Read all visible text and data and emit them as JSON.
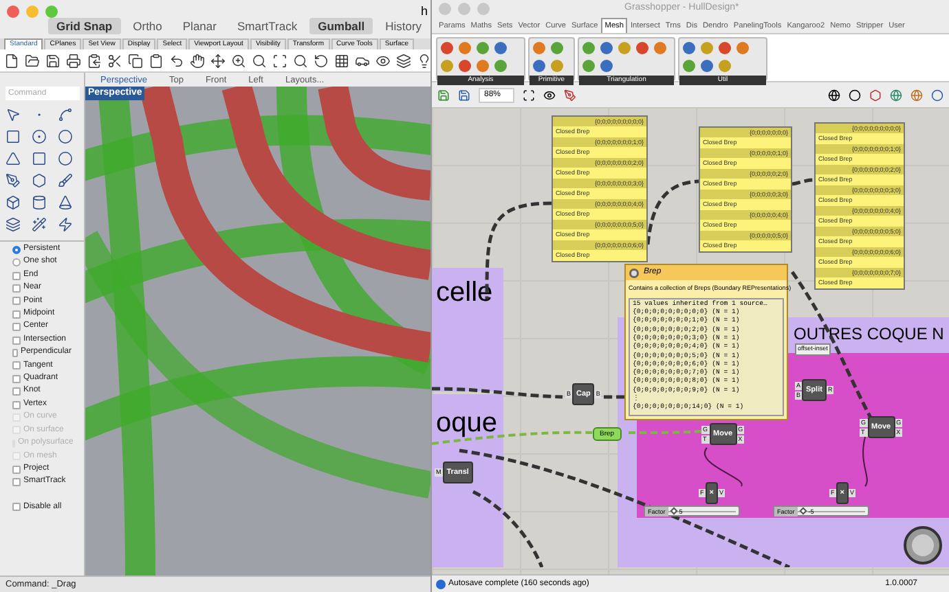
{
  "rhino": {
    "title_fragment": "h",
    "toggles": [
      {
        "label": "Grid Snap",
        "selected": true
      },
      {
        "label": "Ortho",
        "selected": false
      },
      {
        "label": "Planar",
        "selected": false
      },
      {
        "label": "SmartTrack",
        "selected": false
      },
      {
        "label": "Gumball",
        "selected": true
      },
      {
        "label": "History",
        "selected": false
      }
    ],
    "toolbar_tabs": [
      {
        "label": "Standard",
        "selected": true
      },
      {
        "label": "CPlanes",
        "selected": false
      },
      {
        "label": "Set View",
        "selected": false
      },
      {
        "label": "Display",
        "selected": false
      },
      {
        "label": "Select",
        "selected": false
      },
      {
        "label": "Viewport Layout",
        "selected": false
      },
      {
        "label": "Visibility",
        "selected": false
      },
      {
        "label": "Transform",
        "selected": false
      },
      {
        "label": "Curve Tools",
        "selected": false
      },
      {
        "label": "Surface",
        "selected": false
      }
    ],
    "command_field": {
      "placeholder": "Command"
    },
    "osnap": [
      {
        "label": "Persistent",
        "kind": "radio",
        "checked": true,
        "disabled": false
      },
      {
        "label": "One shot",
        "kind": "radio",
        "checked": false,
        "disabled": false
      },
      {
        "label": "End",
        "kind": "check",
        "checked": false,
        "disabled": false
      },
      {
        "label": "Near",
        "kind": "check",
        "checked": false,
        "disabled": false
      },
      {
        "label": "Point",
        "kind": "check",
        "checked": false,
        "disabled": false
      },
      {
        "label": "Midpoint",
        "kind": "check",
        "checked": false,
        "disabled": false
      },
      {
        "label": "Center",
        "kind": "check",
        "checked": false,
        "disabled": false
      },
      {
        "label": "Intersection",
        "kind": "check",
        "checked": false,
        "disabled": false
      },
      {
        "label": "Perpendicular",
        "kind": "check",
        "checked": false,
        "disabled": false
      },
      {
        "label": "Tangent",
        "kind": "check",
        "checked": false,
        "disabled": false
      },
      {
        "label": "Quadrant",
        "kind": "check",
        "checked": false,
        "disabled": false
      },
      {
        "label": "Knot",
        "kind": "check",
        "checked": false,
        "disabled": false
      },
      {
        "label": "Vertex",
        "kind": "check",
        "checked": false,
        "disabled": false
      },
      {
        "label": "On curve",
        "kind": "check",
        "checked": false,
        "disabled": true
      },
      {
        "label": "On surface",
        "kind": "check",
        "checked": false,
        "disabled": true
      },
      {
        "label": "On polysurface",
        "kind": "check",
        "checked": false,
        "disabled": true
      },
      {
        "label": "On mesh",
        "kind": "check",
        "checked": false,
        "disabled": true
      },
      {
        "label": "Project",
        "kind": "check",
        "checked": false,
        "disabled": false
      },
      {
        "label": "SmartTrack",
        "kind": "check",
        "checked": false,
        "disabled": false
      },
      {
        "label": "Disable all",
        "kind": "footer",
        "checked": false,
        "disabled": false
      }
    ],
    "viewport_tabs": [
      {
        "label": "Perspective",
        "selected": true
      },
      {
        "label": "Top",
        "selected": false
      },
      {
        "label": "Front",
        "selected": false
      },
      {
        "label": "Left",
        "selected": false
      },
      {
        "label": "Layouts...",
        "selected": false
      }
    ],
    "viewport_label": "Perspective",
    "command_line": "Command: _Drag"
  },
  "grasshopper": {
    "title": "Grasshopper - HullDesign*",
    "menu_tabs": [
      {
        "label": "Params",
        "selected": false
      },
      {
        "label": "Maths",
        "selected": false
      },
      {
        "label": "Sets",
        "selected": false
      },
      {
        "label": "Vector",
        "selected": false
      },
      {
        "label": "Curve",
        "selected": false
      },
      {
        "label": "Surface",
        "selected": false
      },
      {
        "label": "Mesh",
        "selected": true
      },
      {
        "label": "Intersect",
        "selected": false
      },
      {
        "label": "Trns",
        "selected": false
      },
      {
        "label": "Dis",
        "selected": false
      },
      {
        "label": "Dendro",
        "selected": false
      },
      {
        "label": "PanelingTools",
        "selected": false
      },
      {
        "label": "Kangaroo2",
        "selected": false
      },
      {
        "label": "Nemo",
        "selected": false
      },
      {
        "label": "Stripper",
        "selected": false
      },
      {
        "label": "User",
        "selected": false
      }
    ],
    "ribbon_groups": [
      "Analysis",
      "Primitive",
      "Triangulation",
      "Util"
    ],
    "zoom": "88%",
    "groups": [
      "celle",
      "oque",
      "OUTRES COQUE N"
    ],
    "group_tag": "offset-inset",
    "panels": [
      {
        "rows": [
          {
            "path": "{0;0;0;0;0;0;0;0;0}",
            "value": "Closed Brep"
          },
          {
            "path": "{0;0;0;0;0;0;0;1;0}",
            "value": "Closed Brep"
          },
          {
            "path": "{0;0;0;0;0;0;0;2;0}",
            "value": "Closed Brep"
          },
          {
            "path": "{0;0;0;0;0;0;0;3;0}",
            "value": "Closed Brep"
          },
          {
            "path": "{0;0;0;0;0;0;0;4;0}",
            "value": "Closed Brep"
          },
          {
            "path": "{0;0;0;0;0;0;0;5;0}",
            "value": "Closed Brep"
          },
          {
            "path": "{0;0;0;0;0;0;0;6;0}",
            "value": "Closed Brep"
          }
        ]
      },
      {
        "rows": [
          {
            "path": "{0;0;0;0;0;0;0}",
            "value": "Closed Brep"
          },
          {
            "path": "{0;0;0;0;0;1;0}",
            "value": "Closed Brep"
          },
          {
            "path": "{0;0;0;0;0;2;0}",
            "value": "Closed Brep"
          },
          {
            "path": "{0;0;0;0;0;3;0}",
            "value": "Closed Brep"
          },
          {
            "path": "{0;0;0;0;0;4;0}",
            "value": "Closed Brep"
          },
          {
            "path": "{0;0;0;0;0;5;0}",
            "value": "Closed Brep"
          }
        ]
      },
      {
        "rows": [
          {
            "path": "{0;0;0;0;0;0;0;0;0}",
            "value": "Closed Brep"
          },
          {
            "path": "{0;0;0;0;0;0;0;1;0}",
            "value": "Closed Brep"
          },
          {
            "path": "{0;0;0;0;0;0;0;2;0}",
            "value": "Closed Brep"
          },
          {
            "path": "{0;0;0;0;0;0;0;3;0}",
            "value": "Closed Brep"
          },
          {
            "path": "{0;0;0;0;0;0;0;4;0}",
            "value": "Closed Brep"
          },
          {
            "path": "{0;0;0;0;0;0;0;5;0}",
            "value": "Closed Brep"
          },
          {
            "path": "{0;0;0;0;0;0;0;6;0}",
            "value": "Closed Brep"
          },
          {
            "path": "{0;0;0;0;0;0;0;7;0}",
            "value": "Closed Brep"
          }
        ]
      }
    ],
    "components": [
      {
        "label": "Cap",
        "inputs": [
          "B"
        ],
        "outputs": [
          "B"
        ]
      },
      {
        "label": "Move",
        "inputs": [
          "G",
          "T"
        ],
        "outputs": [
          "G",
          "X"
        ]
      },
      {
        "label": "Split",
        "inputs": [
          "A",
          "B"
        ],
        "outputs": [
          "R"
        ]
      },
      {
        "label": "Move",
        "inputs": [
          "G",
          "T"
        ],
        "outputs": [
          "G",
          "X"
        ]
      },
      {
        "label": "×",
        "inputs": [
          "F"
        ],
        "outputs": [
          "V"
        ]
      },
      {
        "label": "×",
        "inputs": [
          "F"
        ],
        "outputs": [
          "V"
        ]
      },
      {
        "label": "Transl",
        "inputs": [
          "M"
        ]
      }
    ],
    "param": "Brep",
    "sliders": [
      {
        "label": "Factor",
        "value": "5",
        "level": 0.05
      },
      {
        "label": "Factor",
        "value": "-5",
        "level": 0.05
      }
    ],
    "tooltip": {
      "title": "Brep",
      "description": "Contains a collection of Breps (Boundary REPresentations)",
      "lines": [
        "15 values inherited from 1 source…",
        "{0;0;0;0;0;0;0;0;0} (N = 1)",
        "{0;0;0;0;0;0;0;1;0} (N = 1)",
        "{0;0;0;0;0;0;0;2;0} (N = 1)",
        "{0;0;0;0;0;0;0;3;0} (N = 1)",
        "{0;0;0;0;0;0;0;4;0} (N = 1)",
        "{0;0;0;0;0;0;0;5;0} (N = 1)",
        "{0;0;0;0;0;0;0;6;0} (N = 1)",
        "{0;0;0;0;0;0;0;7;0} (N = 1)",
        "{0;0;0;0;0;0;0;8;0} (N = 1)",
        "{0;0;0;0;0;0;0;9;0} (N = 1)",
        "⋮",
        "{0;0;0;0;0;0;0;14;0} (N = 1)"
      ]
    },
    "status": "Autosave complete (160 seconds ago)",
    "version": "1.0.0007"
  }
}
